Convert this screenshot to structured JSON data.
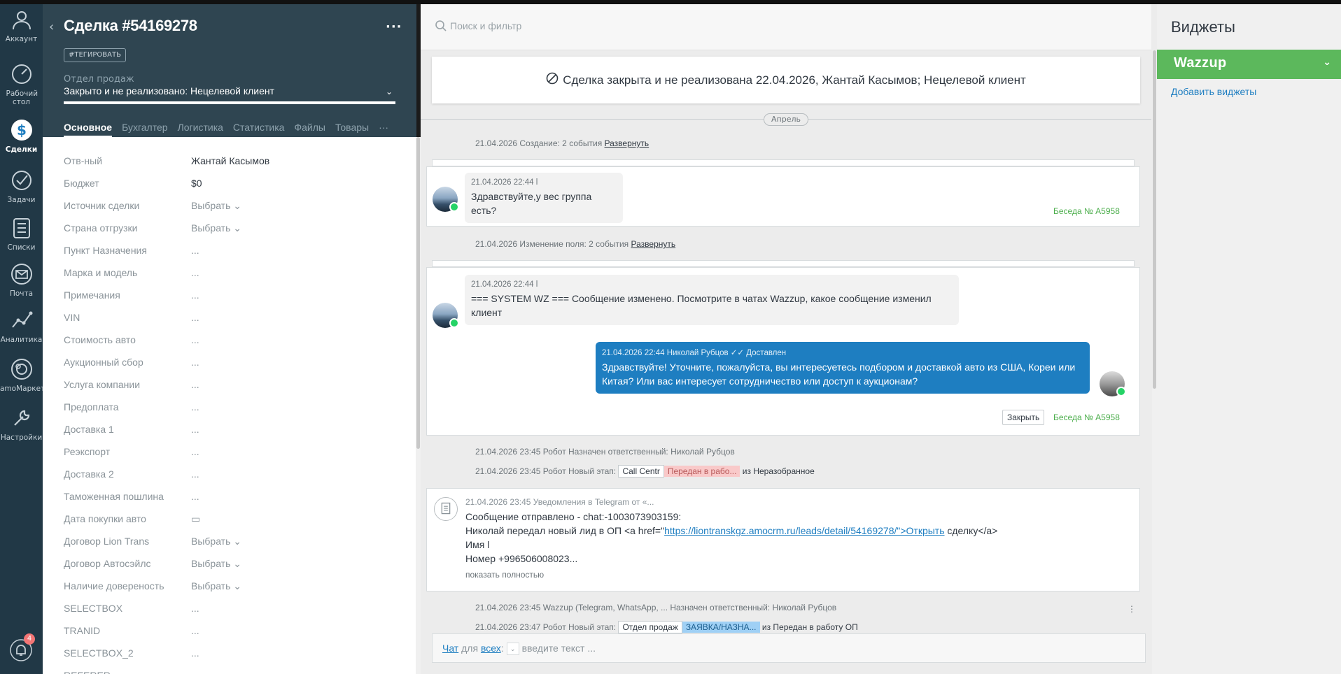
{
  "nav": {
    "items": [
      {
        "label": "Аккаунт",
        "icon": "account-icon"
      },
      {
        "label": "Рабочий стол",
        "icon": "dashboard-icon"
      },
      {
        "label": "Сделки",
        "icon": "deals-icon"
      },
      {
        "label": "Задачи",
        "icon": "tasks-icon"
      },
      {
        "label": "Списки",
        "icon": "lists-icon"
      },
      {
        "label": "Почта",
        "icon": "mail-icon"
      },
      {
        "label": "Аналитика",
        "icon": "analytics-icon"
      },
      {
        "label": "amoМаркет",
        "icon": "market-icon"
      },
      {
        "label": "Настройки",
        "icon": "settings-icon"
      }
    ],
    "notifications_count": "4"
  },
  "deal": {
    "title": "Сделка #54169278",
    "tag_button": "#ТЕГИРОВАТЬ",
    "pipeline": "Отдел продаж",
    "status": "Закрыто и не реализовано: Нецелевой клиент",
    "tabs": [
      "Основное",
      "Бухгалтер",
      "Логистика",
      "Статистика",
      "Файлы",
      "Товары"
    ],
    "tabs_more": "···",
    "fields": [
      {
        "label": "Отв-ный",
        "value": "Жантай Касымов"
      },
      {
        "label": "Бюджет",
        "value": "$0"
      },
      {
        "label": "Источник сделки",
        "value": "Выбрать ⌄"
      },
      {
        "label": "Страна отгрузки",
        "value": "Выбрать ⌄"
      },
      {
        "label": "Пункт Назначения",
        "value": "..."
      },
      {
        "label": "Марка и модель",
        "value": "..."
      },
      {
        "label": "Примечания",
        "value": "..."
      },
      {
        "label": "VIN",
        "value": "..."
      },
      {
        "label": "Стоимость авто",
        "value": "..."
      },
      {
        "label": "Аукционный сбор",
        "value": "..."
      },
      {
        "label": "Услуга компании",
        "value": "..."
      },
      {
        "label": "Предоплата",
        "value": "..."
      },
      {
        "label": "Доставка 1",
        "value": "..."
      },
      {
        "label": "Реэкспорт",
        "value": "..."
      },
      {
        "label": "Доставка 2",
        "value": "..."
      },
      {
        "label": "Таможенная пошлина",
        "value": "..."
      },
      {
        "label": "Дата покупки авто",
        "value": "▭"
      },
      {
        "label": "Договор Lion Trans",
        "value": "Выбрать ⌄"
      },
      {
        "label": "Договор Автосэйлс",
        "value": "Выбрать ⌄"
      },
      {
        "label": "Наличие довереность",
        "value": "Выбрать ⌄"
      },
      {
        "label": "SELECTBOX",
        "value": "..."
      },
      {
        "label": "TRANID",
        "value": "..."
      },
      {
        "label": "SELECTBOX_2",
        "value": "..."
      },
      {
        "label": "REFERER",
        "value": ""
      }
    ]
  },
  "feed": {
    "search_placeholder": "Поиск и фильтр",
    "closed_banner": "Сделка закрыта и не реализована 22.04.2026, Жантай Касымов; Нецелевой клиент",
    "month": "Апрель",
    "event1_text": "21.04.2026 Создание: 2 события ",
    "event1_link": "Развернуть",
    "msg1_meta": "21.04.2026 22:44 l",
    "msg1_text": "Здравствуйте,у вес группа есть?",
    "conv_link": "Беседа № A5958",
    "event2_text": "21.04.2026 Изменение поля: 2 события ",
    "event2_link": "Развернуть",
    "msg2_meta": "21.04.2026 22:44 l",
    "msg2_text": "=== SYSTEM WZ === Сообщение изменено. Посмотрите в чатах Wazzup, какое сообщение изменил клиент",
    "msg3_meta": "21.04.2026 22:44 Николай Рубцов ✓✓ Доставлен",
    "msg3_text": "Здравствуйте! Уточните, пожалуйста, вы интересуетесь подбором и доставкой авто из США, Кореи или Китая? Или вас интересует сотрудничество или доступ к аукционам?",
    "close_button": "Закрыть",
    "conv_link2": "Беседа № A5958",
    "event3_text": "21.04.2026 23:45 Робот Назначен ответственный: Николай Рубцов",
    "event4_prefix": "21.04.2026 23:45 Робот Новый этап: ",
    "event4_stage_from": "Call Centr",
    "event4_stage_to": "Передан в рабо...",
    "event4_suffix": " из Неразобранное",
    "notif_meta": "21.04.2026 23:45 Уведомления в Telegram от «...",
    "notif_line1": "Сообщение отправлено - chat:-1003073903159:",
    "notif_line2_prefix": "Николай передал новый лид в ОП <a href=\"",
    "notif_line2_link": "https://liontranskgz.amocrm.ru/leads/detail/54169278/\">Открыть",
    "notif_line2_suffix": " сделку</a>",
    "notif_line3": "Имя l",
    "notif_line4": "Номер +996506008023...",
    "notif_show_all": "показать полностью",
    "event5_text": "21.04.2026 23:45 Wazzup (Telegram, WhatsApp, ... Назначен ответственный: Николай Рубцов",
    "event6_prefix": "21.04.2026 23:47 Робот Новый этап: ",
    "event6_stage_from": "Отдел продаж",
    "event6_stage_to": "ЗАЯВКА/НАЗНА...",
    "event6_suffix": " из Передан в работу ОП",
    "composer_chat": "Чат",
    "composer_for": " для ",
    "composer_all": "всех",
    "composer_colon": ":",
    "composer_placeholder": "введите текст ..."
  },
  "widgets": {
    "title": "Виджеты",
    "wazzup": "Wazzup",
    "add": "Добавить виджеты"
  },
  "colors": {
    "nav_bg": "#213846",
    "deal_header_bg": "#2f4551",
    "outgoing_bubble": "#1e7ec1",
    "wazzup_green": "#5cb85c",
    "stage_red": "#f9c9c9",
    "stage_blue": "#9fd0f5"
  }
}
